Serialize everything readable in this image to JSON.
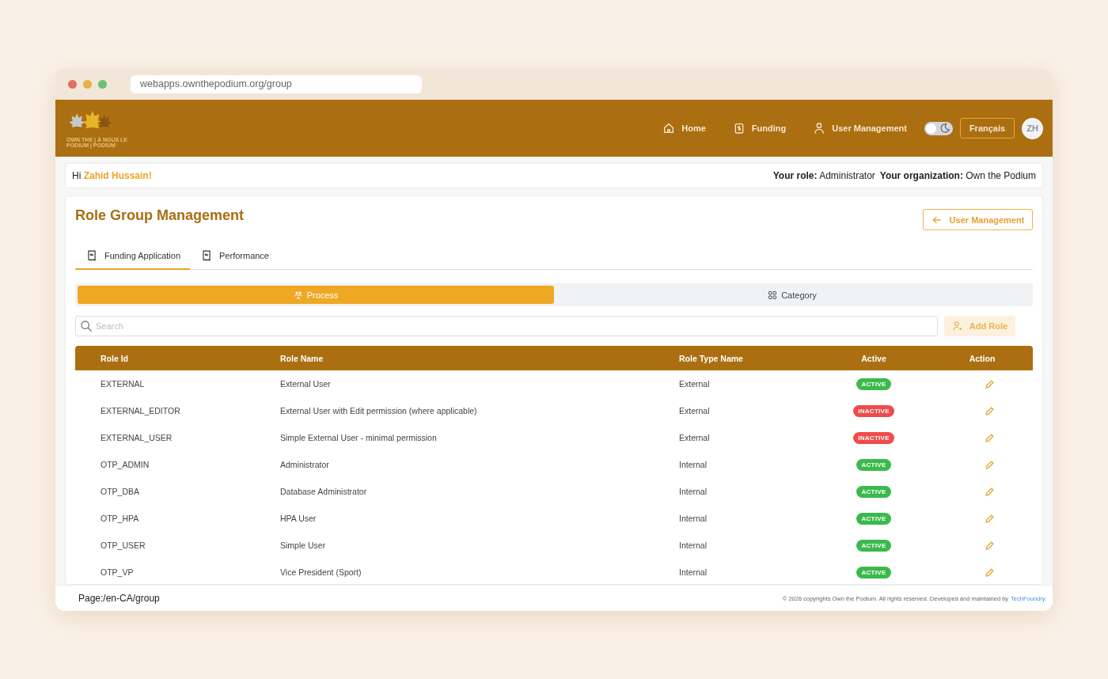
{
  "browser": {
    "url": "webapps.ownthepodium.org/group"
  },
  "header": {
    "logo_lines": [
      "OWN THE | À NOUS LE",
      "PODIUM | PODIUM"
    ],
    "nav": [
      {
        "label": "Home",
        "kind": "home"
      },
      {
        "label": "Funding",
        "kind": "funding"
      },
      {
        "label": "User Management",
        "kind": "user"
      }
    ],
    "dark_mode": {
      "on": false
    },
    "language_button": "Français",
    "avatar": "ZH"
  },
  "greeting": {
    "text": "Hi **Zahid Hussain!**",
    "role": "**Your role:** Administrator",
    "organization": "**Your organization:** Own the Podium"
  },
  "page": {
    "title": "Role Group Management",
    "back_button": "User Management",
    "tabs": [
      {
        "label": "Funding Application",
        "selected": true
      },
      {
        "label": "Performance",
        "selected": false
      }
    ],
    "segments": [
      {
        "label": "Process",
        "kind": "process",
        "selected": true
      },
      {
        "label": "Category",
        "kind": "category",
        "selected": false
      }
    ],
    "search": {
      "placeholder": "Search"
    },
    "add_button": "Add Role",
    "table": {
      "columns": [
        "Role Id",
        "Role Name",
        "Role Type Name",
        "Active",
        "Action"
      ],
      "rows": [
        {
          "role_id": "EXTERNAL",
          "role_name": "External User",
          "role_type": "External",
          "status": "ACTIVE",
          "active": true
        },
        {
          "role_id": "EXTERNAL_EDITOR",
          "role_name": "External User with Edit permission (where applicable)",
          "role_type": "External",
          "status": "INACTIVE",
          "active": false
        },
        {
          "role_id": "EXTERNAL_USER",
          "role_name": "Simple External User - minimal permission",
          "role_type": "External",
          "status": "INACTIVE",
          "active": false
        },
        {
          "role_id": "OTP_ADMIN",
          "role_name": "Administrator",
          "role_type": "Internal",
          "status": "ACTIVE",
          "active": true
        },
        {
          "role_id": "OTP_DBA",
          "role_name": "Database Administrator",
          "role_type": "Internal",
          "status": "ACTIVE",
          "active": true
        },
        {
          "role_id": "OTP_HPA",
          "role_name": "HPA User",
          "role_type": "Internal",
          "status": "ACTIVE",
          "active": true
        },
        {
          "role_id": "OTP_USER",
          "role_name": "Simple User",
          "role_type": "Internal",
          "status": "ACTIVE",
          "active": true
        },
        {
          "role_id": "OTP_VP",
          "role_name": "Vice President (Sport)",
          "role_type": "Internal",
          "status": "ACTIVE",
          "active": true
        }
      ]
    }
  },
  "footer": {
    "page_path": "Page:/en-CA/group",
    "copyright": "© 2026 copyrights Own the Podium. All rights reserved. Developed and maintained by",
    "link": "TechFoundry."
  }
}
